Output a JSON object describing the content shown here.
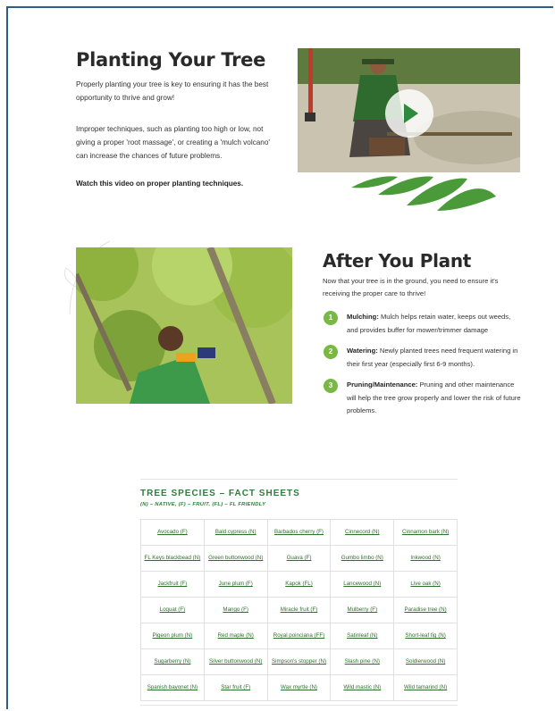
{
  "planting": {
    "title": "Planting Your Tree",
    "para1": "Properly planting your tree is key to ensuring it has the best opportunity to thrive and grow!",
    "para2": "Improper techniques, such as planting too high or low, not giving a proper 'root massage', or creating a 'mulch volcano' can increase the chances of future problems.",
    "watch": "Watch this video on proper planting techniques."
  },
  "after": {
    "title": "After You Plant",
    "intro": "Now that your tree is in the ground, you need to ensure it's receiving the proper care to thrive!",
    "steps": [
      {
        "num": "1",
        "label": "Mulching:",
        "text": " Mulch helps retain water, keeps out weeds, and provides buffer for mower/trimmer damage"
      },
      {
        "num": "2",
        "label": "Watering:",
        "text": " Newly planted trees need frequent watering in their first year (especially first 6-9 months)."
      },
      {
        "num": "3",
        "label": "Pruning/Maintenance:",
        "text": " Pruning and other maintenance will help the tree grow properly and lower the risk of future problems."
      }
    ]
  },
  "fact_sheets": {
    "title": "TREE SPECIES – FACT SHEETS",
    "subtitle": "(N) – NATIVE, (F) – FRUIT, (FL) – FL FRIENDLY",
    "rows": [
      [
        "Avocado (F)",
        "Bald cypress (N)",
        "Barbados cherry (F)",
        "Cinnecord (N)",
        "Cinnamon bark (N)"
      ],
      [
        "FL Keys blackbead (N)",
        "Green buttonwood (N)",
        "Guava (F)",
        "Gumbo limbo (N)",
        "Inkwood (N)"
      ],
      [
        "Jackfruit (F)",
        "June plum (F)",
        "Kapok (FL)",
        "Lancewood (N)",
        "Live oak (N)"
      ],
      [
        "Loquat (F)",
        "Mango (F)",
        "Miracle fruit (F)",
        "Mulberry (F)",
        "Paradise tree (N)"
      ],
      [
        "Pigeon plum (N)",
        "Red maple (N)",
        "Royal poinciana (FF)",
        "Satinleaf (N)",
        "Short-leaf fig (N)"
      ],
      [
        "Sugarberry (N)",
        "Silver buttonwood (N)",
        "Simpson's stopper (N)",
        "Slash pine (N)",
        "Soldierwood (N)"
      ],
      [
        "Spanish bayonet (N)",
        "Star fruit (F)",
        "Wax myrtle (N)",
        "Wild mastic (N)",
        "Wild tamarind (N)"
      ]
    ]
  },
  "colors": {
    "accent": "#78b843",
    "green_text": "#2e7d3a",
    "frame": "#2d5b8a"
  },
  "icons": {
    "video": "play-icon"
  }
}
